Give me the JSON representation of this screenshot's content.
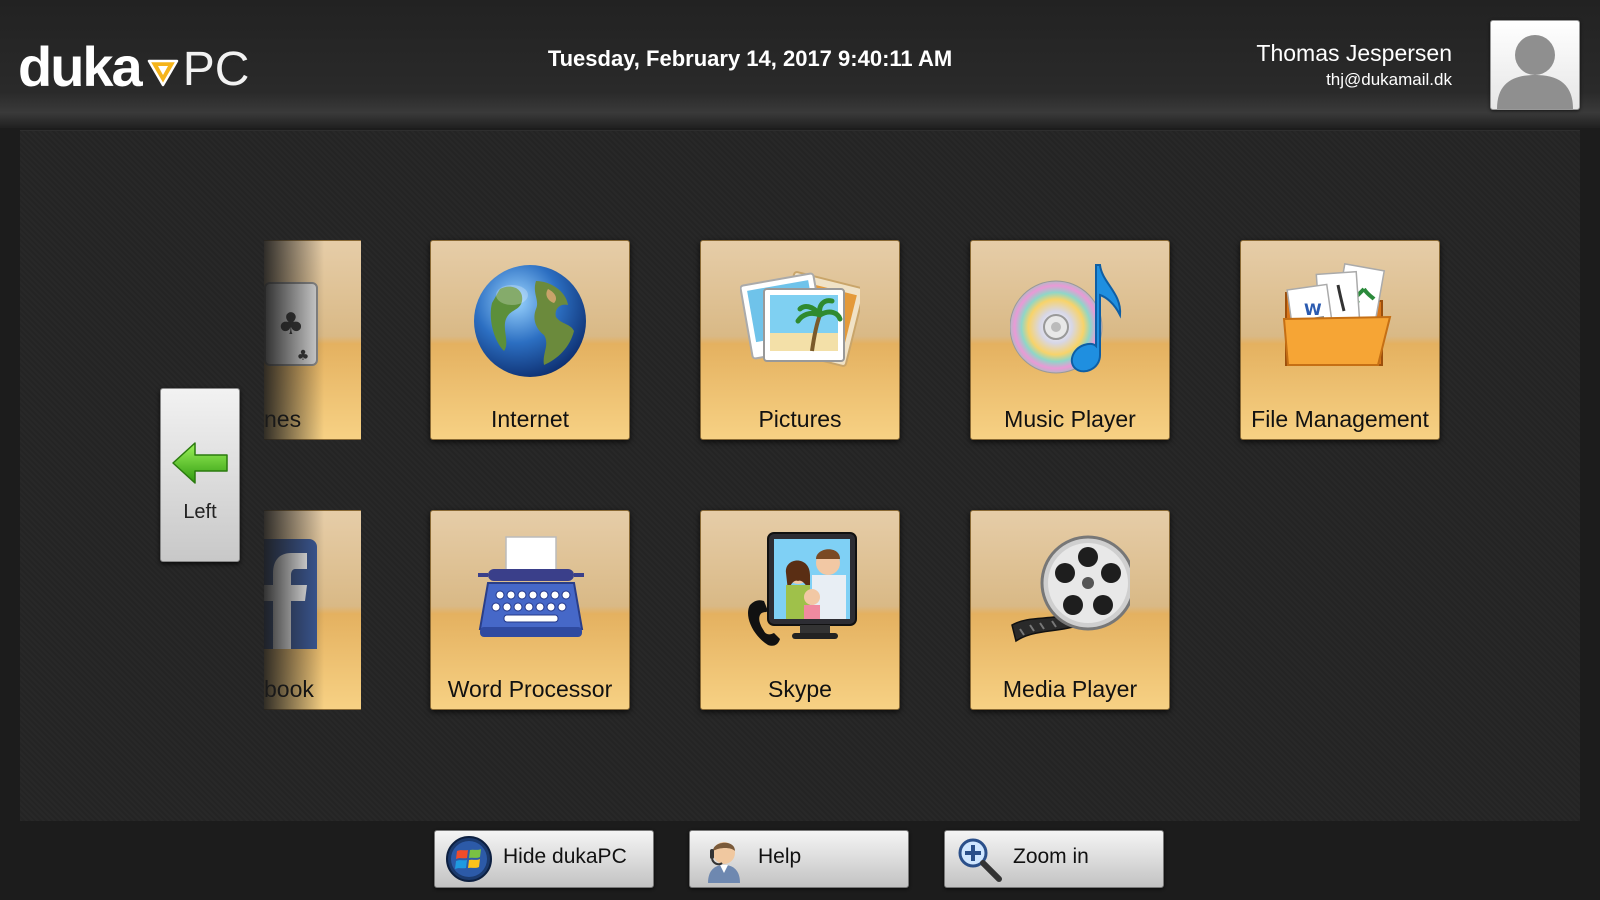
{
  "header": {
    "logo_main": "duka",
    "logo_suffix": "PC",
    "datetime": "Tuesday, February 14, 2017 9:40:11 AM",
    "user_name": "Thomas Jespersen",
    "user_email": "thj@dukamail.dk"
  },
  "nav": {
    "left_label": "Left"
  },
  "tiles": {
    "partial_top": {
      "label": "nes",
      "icon": "playing-card-icon"
    },
    "internet": {
      "label": "Internet",
      "icon": "globe-icon"
    },
    "pictures": {
      "label": "Pictures",
      "icon": "photos-icon"
    },
    "music_player": {
      "label": "Music Player",
      "icon": "cd-music-note-icon"
    },
    "file_management": {
      "label": "File Management",
      "icon": "folder-documents-icon"
    },
    "partial_bottom": {
      "label": "book",
      "icon": "facebook-icon"
    },
    "word_processor": {
      "label": "Word Processor",
      "icon": "typewriter-icon"
    },
    "skype": {
      "label": "Skype",
      "icon": "video-call-icon"
    },
    "media_player": {
      "label": "Media Player",
      "icon": "film-reel-icon"
    }
  },
  "toolbar": {
    "hide_label": "Hide dukaPC",
    "help_label": "Help",
    "zoom_label": "Zoom in"
  },
  "colors": {
    "background": "#1c1c1c",
    "tile_gold": "#e4b160",
    "logo_accent": "#f5b41a"
  }
}
